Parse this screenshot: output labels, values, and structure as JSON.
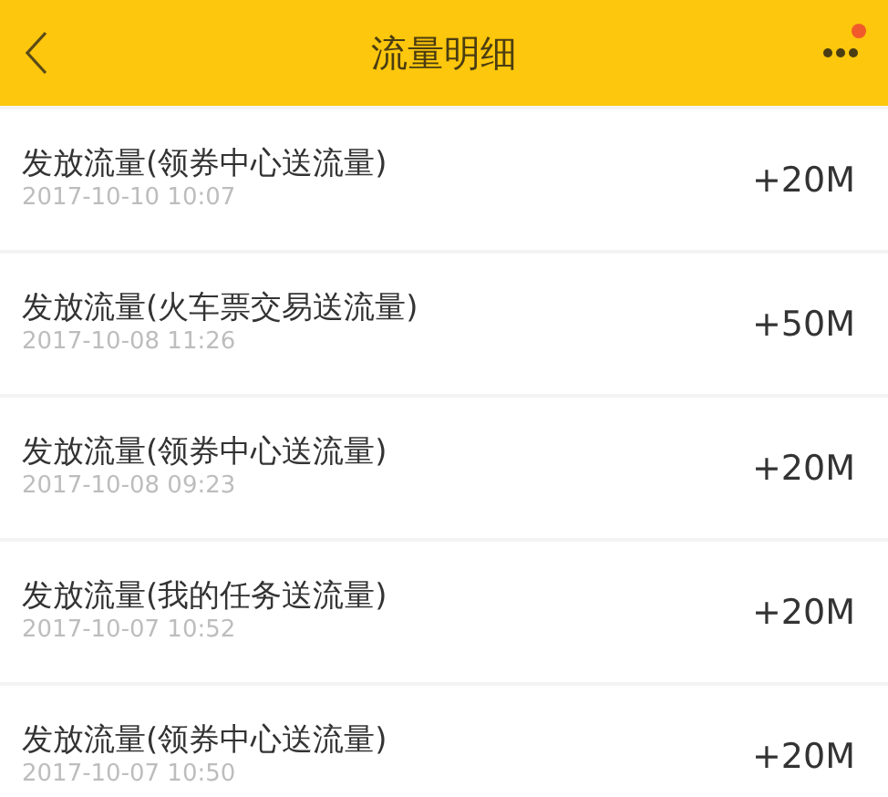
{
  "header": {
    "title": "流量明细",
    "menu_badge": true
  },
  "records": [
    {
      "title": "发放流量(领券中心送流量)",
      "time": "2017-10-10 10:07",
      "amount": "+20M"
    },
    {
      "title": "发放流量(火车票交易送流量)",
      "time": "2017-10-08 11:26",
      "amount": "+50M"
    },
    {
      "title": "发放流量(领券中心送流量)",
      "time": "2017-10-08 09:23",
      "amount": "+20M"
    },
    {
      "title": "发放流量(我的任务送流量)",
      "time": "2017-10-07 10:52",
      "amount": "+20M"
    },
    {
      "title": "发放流量(领券中心送流量)",
      "time": "2017-10-07 10:50",
      "amount": "+20M"
    }
  ]
}
